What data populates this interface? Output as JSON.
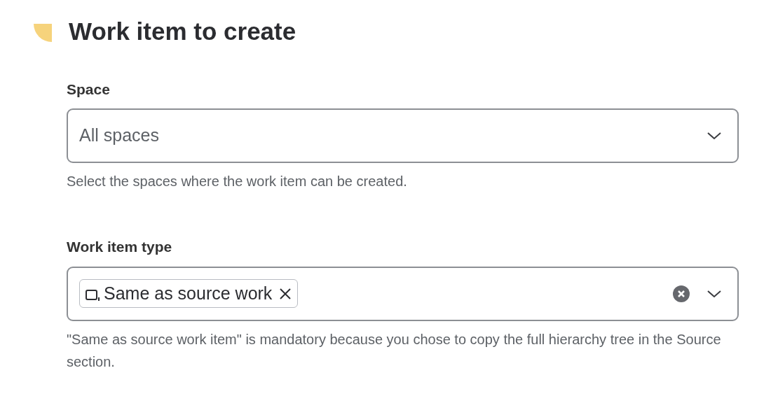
{
  "title": "Work item to create",
  "fields": [
    {
      "kind": "select",
      "label": "Space",
      "value": "All spaces",
      "help": "Select the spaces where the work item can be created."
    },
    {
      "kind": "multiselect",
      "label": "Work item type",
      "chips": [
        "Same as source work"
      ],
      "help": "\"Same as source work item\" is mandatory because you chose to copy the full hierarchy tree in the Source section."
    }
  ]
}
